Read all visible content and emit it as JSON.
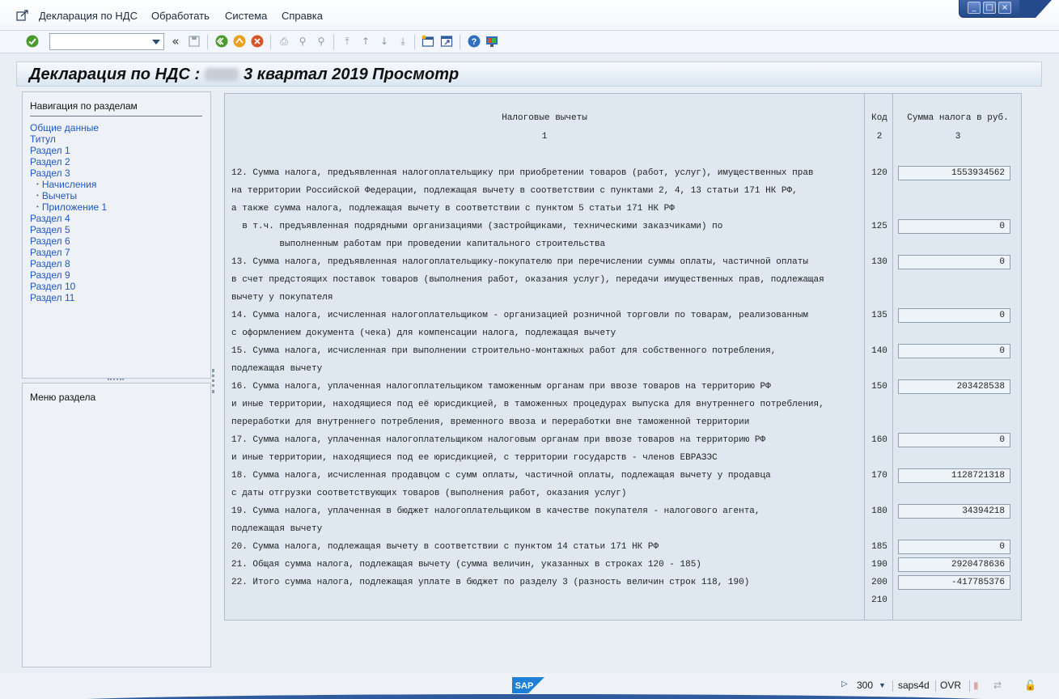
{
  "menu": {
    "items": [
      {
        "label": "Декларация по НДС",
        "accel": "Д"
      },
      {
        "label": "Обработать",
        "accel": "О"
      },
      {
        "label": "Система",
        "accel": "С"
      },
      {
        "label": "Справка",
        "accel": "С"
      }
    ]
  },
  "toolbar": {
    "command_value": ""
  },
  "title": {
    "prefix": "Декларация по НДС :",
    "suffix": "3 квартал 2019 Просмотр"
  },
  "nav": {
    "heading": "Навигация по разделам",
    "items": [
      {
        "label": "Общие данные",
        "sub": false
      },
      {
        "label": "Титул",
        "sub": false
      },
      {
        "label": "Раздел 1",
        "sub": false
      },
      {
        "label": "Раздел 2",
        "sub": false
      },
      {
        "label": "Раздел 3",
        "sub": false
      },
      {
        "label": "Начисления",
        "sub": true
      },
      {
        "label": "Вычеты",
        "sub": true
      },
      {
        "label": "Приложение 1",
        "sub": true
      },
      {
        "label": "Раздел 4",
        "sub": false
      },
      {
        "label": "Раздел 5",
        "sub": false
      },
      {
        "label": "Раздел 6",
        "sub": false
      },
      {
        "label": "Раздел 7",
        "sub": false
      },
      {
        "label": "Раздел 8",
        "sub": false
      },
      {
        "label": "Раздел 9",
        "sub": false
      },
      {
        "label": "Раздел 10",
        "sub": false
      },
      {
        "label": "Раздел 11",
        "sub": false
      }
    ]
  },
  "section_menu": {
    "heading": "Меню раздела"
  },
  "table": {
    "col1_header": "Налоговые вычеты",
    "col1_num": "1",
    "col2_header": "Код",
    "col2_num": "2",
    "col3_header": "Сумма налога в руб.",
    "col3_num": "3",
    "rows": [
      {
        "lines": [
          "12. Сумма налога, предъявленная налогоплательщику при приобретении товаров (работ, услуг), имущественных прав",
          "на территории Российской Федерации, подлежащая вычету в соответствии с пунктами 2, 4, 13 статьи 171 НК РФ,",
          "а также сумма налога, подлежащая вычету в соответствии с пунктом 5 статьи 171 НК РФ"
        ],
        "code": "120",
        "amount": "1553934562"
      },
      {
        "lines": [
          "  в т.ч. предъявленная подрядными организациями (застройщиками, техническими заказчиками) по",
          "         выполненным работам при проведении капитального строительства"
        ],
        "code": "125",
        "amount": "0"
      },
      {
        "lines": [
          "13. Сумма налога, предъявленная налогоплательщику-покупателю при перечислении суммы оплаты, частичной оплаты",
          "в счет предстоящих поставок товаров (выполнения работ, оказания услуг), передачи имущественных прав, подлежащая",
          "вычету у покупателя"
        ],
        "code": "130",
        "amount": "0"
      },
      {
        "lines": [
          "14. Сумма налога, исчисленная налогоплательщиком - организацией розничной торговли по товарам, реализованным",
          "с оформлением документа (чека) для компенсации налога, подлежащая вычету"
        ],
        "code": "135",
        "amount": "0"
      },
      {
        "lines": [
          "15. Сумма налога, исчисленная при выполнении строительно-монтажных работ для собственного потребления,",
          "подлежащая вычету"
        ],
        "code": "140",
        "amount": "0"
      },
      {
        "lines": [
          "16. Сумма налога, уплаченная налогоплательщиком таможенным органам при ввозе товаров на территорию РФ",
          "и иные территории, находящиеся под её юрисдикцией, в таможенных процедурах выпуска для внутреннего потребления,",
          "переработки для внутреннего потребления, временного ввоза и переработки вне таможенной территории"
        ],
        "code": "150",
        "amount": "203428538"
      },
      {
        "lines": [
          "17. Сумма налога, уплаченная налогоплательщиком налоговым органам при ввозе товаров на территорию РФ",
          "и иные территории, находящиеся под ее юрисдикцией, с территории государств - членов ЕВРАЗЭС"
        ],
        "code": "160",
        "amount": "0"
      },
      {
        "lines": [
          "18. Сумма налога, исчисленная продавцом с сумм оплаты, частичной оплаты, подлежащая вычету у продавца",
          "с даты отгрузки соответствующих товаров (выполнения работ, оказания услуг)"
        ],
        "code": "170",
        "amount": "1128721318"
      },
      {
        "lines": [
          "19. Сумма налога, уплаченная в бюджет налогоплательщиком в качестве покупателя - налогового агента,",
          "подлежащая вычету"
        ],
        "code": "180",
        "amount": "34394218"
      },
      {
        "lines": [
          "20. Сумма налога, подлежащая вычету в соответствии с пунктом 14 статьи 171 НК РФ"
        ],
        "code": "185",
        "amount": "0"
      },
      {
        "lines": [
          "21. Общая сумма налога, подлежащая вычету (сумма величин, указанных в строках 120 - 185)"
        ],
        "code": "190",
        "amount": "2920478636"
      },
      {
        "lines": [
          "22. Итого сумма налога, подлежащая уплате в бюджет по разделу 3 (разность величин строк 118, 190)"
        ],
        "code": "200",
        "amount": "-417785376"
      },
      {
        "lines": [],
        "code": "210",
        "amount": null
      }
    ]
  },
  "status": {
    "client": "300",
    "system": "saps4d",
    "mode": "OVR",
    "logo": "SAP"
  }
}
